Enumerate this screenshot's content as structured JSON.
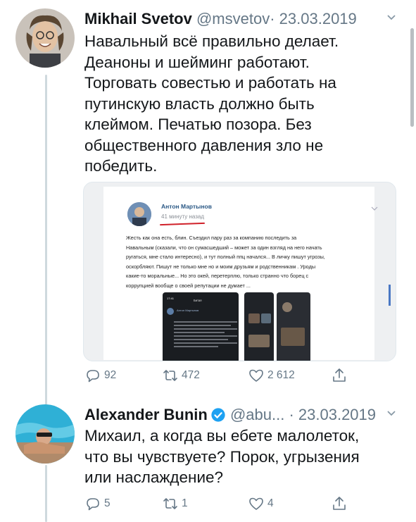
{
  "tweets": [
    {
      "name": "Mikhail Svetov",
      "handle": "@msvetov",
      "separator": "·",
      "date": "23.03.2019",
      "text_lines": [
        "Навальный всё правильно делает.",
        "Деаноны и шейминг работают.",
        "Торговать совестью и работать на",
        "путинскую власть должно быть",
        "клеймом. Печатью позора. Без",
        "общественного давления зло не",
        "победить."
      ],
      "embedded": {
        "author": "Антон Мартынов",
        "time": "41 минуту назад",
        "text_lines": [
          "Жесть как она есть, блин. Съездил пару раз за компанию последить за",
          "Навальным (сказали, что он сумасшедший – может за один взгляд на него начать",
          "ругаться, мне стало интересно), и тут полный ппц начался... В личку пишут угрозы,",
          "оскорбляют. Пишут не только мне но и моим друзьям и родственникам . Уроды",
          "какие-то моральные... Но это окей, перетерплю, только странно что борец с",
          "коррупцией вообще о своей репутации не думает ..."
        ],
        "screenshot_author": "Антон Мартынов",
        "screenshot_title": "Битая"
      },
      "actions": {
        "replies": "92",
        "retweets": "472",
        "likes": "2 612"
      }
    },
    {
      "name": "Alexander Bunin",
      "handle": "@abu...",
      "separator": "·",
      "date": "23.03.2019",
      "text_lines": [
        "Михаил, а когда вы ебете малолеток,",
        "что вы чувствуете? Порок, угрызения",
        "или наслаждение?"
      ],
      "actions": {
        "replies": "5",
        "retweets": "1",
        "likes": "4"
      }
    }
  ],
  "icons": {
    "reply": "reply-icon",
    "retweet": "retweet-icon",
    "like": "heart-icon",
    "share": "share-icon",
    "verified": "verified-badge-icon",
    "chevron": "chevron-down-icon"
  },
  "colors": {
    "text": "#14171a",
    "secondary": "#657786",
    "verified": "#1da1f2",
    "thread_line": "#cfd9de",
    "underline": "#d0212a"
  }
}
